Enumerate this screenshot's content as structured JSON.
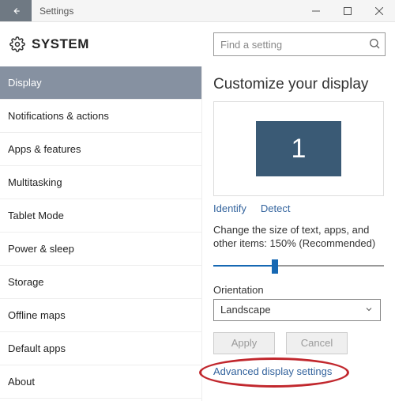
{
  "titlebar": {
    "title": "Settings"
  },
  "header": {
    "system": "SYSTEM",
    "searchPlaceholder": "Find a setting"
  },
  "sidebar": {
    "items": [
      {
        "label": "Display",
        "active": true
      },
      {
        "label": "Notifications & actions"
      },
      {
        "label": "Apps & features"
      },
      {
        "label": "Multitasking"
      },
      {
        "label": "Tablet Mode"
      },
      {
        "label": "Power & sleep"
      },
      {
        "label": "Storage"
      },
      {
        "label": "Offline maps"
      },
      {
        "label": "Default apps"
      },
      {
        "label": "About"
      }
    ]
  },
  "content": {
    "heading": "Customize your display",
    "monitorNumber": "1",
    "identify": "Identify",
    "detect": "Detect",
    "scaleText": "Change the size of text, apps, and other items: 150% (Recommended)",
    "orientationLabel": "Orientation",
    "orientationValue": "Landscape",
    "apply": "Apply",
    "cancel": "Cancel",
    "advanced": "Advanced display settings"
  }
}
